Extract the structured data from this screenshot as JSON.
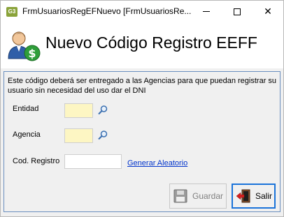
{
  "window": {
    "app_icon_text": "G3",
    "title": "FrmUsuariosRegEFNuevo [FrmUsuariosRe...",
    "close_glyph": "✕"
  },
  "header": {
    "title": "Nuevo Código Registro EEFF",
    "icon": "user-money-icon"
  },
  "form": {
    "description": "Este código deberá ser entregado a las Agencias para que puedan registrar su usuario sin necesidad del uso dar el DNI",
    "entidad": {
      "label": "Entidad",
      "value": ""
    },
    "agencia": {
      "label": "Agencia",
      "value": ""
    },
    "codigo": {
      "label": "Cod. Registro",
      "value": ""
    },
    "generate_link": "Generar Aleatorio"
  },
  "buttons": {
    "save_label": "Guardar",
    "exit_label": "Salir"
  },
  "colors": {
    "lookup_field": "#fdf6c3",
    "link": "#0033cc",
    "panel_border": "#6a8fbf",
    "focus_border": "#1a73d9"
  }
}
